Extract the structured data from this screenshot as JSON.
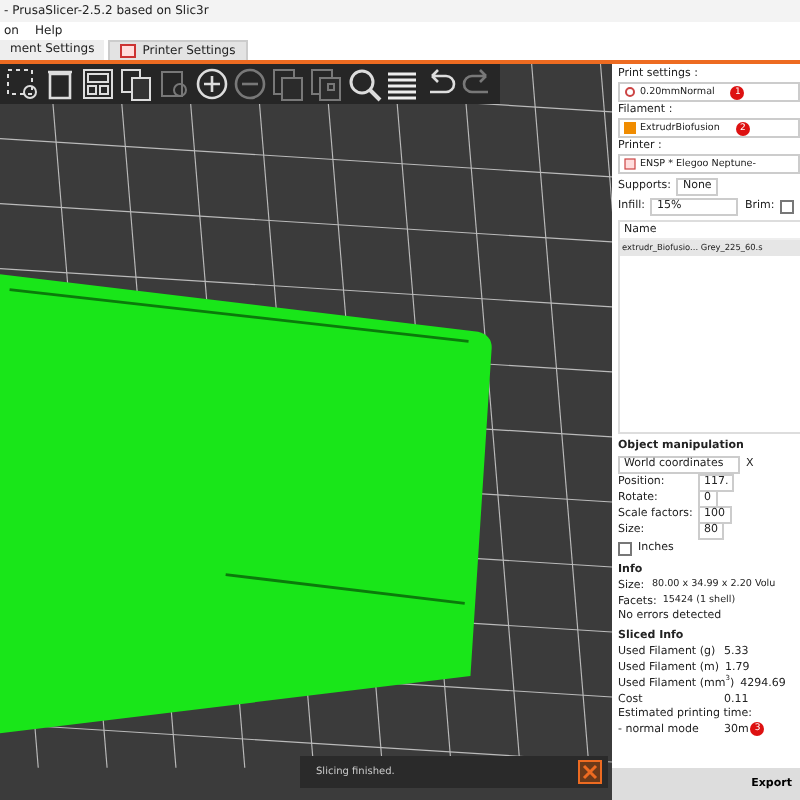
{
  "window": {
    "title": "- PrusaSlicer-2.5.2 based on Slic3r"
  },
  "menu": [
    "on",
    "Help"
  ],
  "tabs": [
    {
      "label": "ment Settings",
      "selected": false
    },
    {
      "label": "Printer Settings",
      "selected": true
    }
  ],
  "toolbar": [
    {
      "kind": "select"
    },
    {
      "kind": "delete"
    },
    {
      "kind": "arrange"
    },
    {
      "kind": "copy"
    },
    {
      "kind": "paste",
      "disabled": true
    },
    {
      "kind": "add"
    },
    {
      "kind": "remove",
      "disabled": true
    },
    {
      "kind": "split",
      "disabled": true
    },
    {
      "kind": "parts",
      "disabled": true
    },
    {
      "kind": "search"
    },
    {
      "kind": "layers"
    },
    {
      "kind": "undo"
    },
    {
      "kind": "redo",
      "disabled": true
    }
  ],
  "notification": {
    "text": "Slicing finished."
  },
  "sidebar": {
    "presets": [
      {
        "label": "Print settings :",
        "value": "0.20mmNormal",
        "badge": "1",
        "kind": "print"
      },
      {
        "label": "Filament :",
        "value": "ExtrudrBiofusion",
        "badge": "2",
        "kind": "filament",
        "color": "#f08c00"
      },
      {
        "label": "Printer :",
        "value": "ENSP * Elegoo Neptune-",
        "kind": "printer"
      }
    ],
    "supports": {
      "label": "Supports:",
      "value": "None"
    },
    "infill": {
      "label": "Infill:",
      "value": "15%"
    },
    "brim": {
      "label": "Brim:",
      "checked": false
    },
    "objects": {
      "header": "Name",
      "rows": [
        {
          "name": "extrudr_Biofusio... Grey_225_60.s",
          "selected": true
        }
      ]
    },
    "manipulation": {
      "title": "Object manipulation",
      "coords": "World coordinates",
      "axis": "X",
      "rows": [
        {
          "label": "Position:",
          "value": "117."
        },
        {
          "label": "Rotate:",
          "value": "0"
        },
        {
          "label": "Scale factors:",
          "value": "100"
        },
        {
          "label": "Size:",
          "value": "80"
        }
      ],
      "inches": {
        "label": "Inches",
        "checked": false
      }
    },
    "info": {
      "title": "Info",
      "rows": [
        {
          "label": "Size:",
          "value": "80.00 x 34.99 x 2.20  Volu"
        },
        {
          "label": "Facets:",
          "value": "15424 (1 shell)"
        }
      ],
      "status": "No errors detected"
    },
    "sliced": {
      "title": "Sliced Info",
      "rows": [
        {
          "label": "Used Filament (g)",
          "value": "5.33"
        },
        {
          "label": "Used Filament (m)",
          "value": "1.79"
        },
        {
          "label": "Used Filament (mm$^{3}$)",
          "value": "4294.69"
        },
        {
          "label": "Cost",
          "value": "0.11"
        }
      ],
      "time_label": "Estimated printing time:",
      "mode": {
        "label": "- normal mode",
        "value": "30m",
        "badge": "3"
      }
    },
    "export": "Export"
  }
}
